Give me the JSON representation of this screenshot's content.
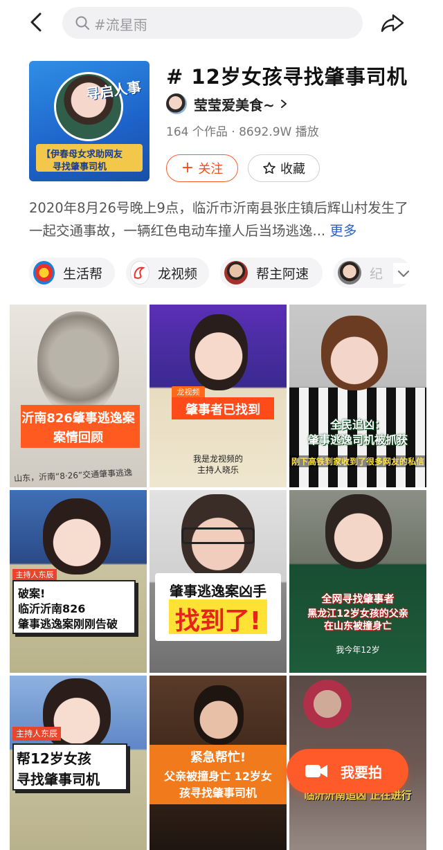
{
  "search": {
    "placeholder": "#流星雨"
  },
  "topic": {
    "title": "# 12岁女孩寻找肇事司机",
    "cover_brand": "寻启人事",
    "cover_banner_line1": "【伊春母女求助网友",
    "cover_banner_line2": "寻找肇事司机"
  },
  "author": {
    "name": "莹莹爱美食~"
  },
  "stats": "164 个作品 · 8692.9W 播放",
  "buttons": {
    "follow": "关注",
    "favorite": "收藏"
  },
  "description": {
    "text": "2020年8月26号晚上9点，临沂市沂南县张庄镇后辉山村发生了一起交通事故，一辆红色电动车撞人后当场逃逸...",
    "more": "更多"
  },
  "creators": [
    {
      "name": "生活帮"
    },
    {
      "name": "龙视频"
    },
    {
      "name": "帮主阿速"
    },
    {
      "name": "纪"
    }
  ],
  "videos": [
    {
      "caption1": "沂南826肇事逃逸案",
      "caption2": "案情回顾",
      "extra": "山东，沂南“8·26”交通肇事逃逸"
    },
    {
      "tag": "龙视频",
      "caption1": "肇事者已找到",
      "sub1": "我是龙视频的",
      "sub2": "主持人晓乐"
    },
    {
      "caption1": "全民追凶：",
      "caption2": "肇事逃逸司机被抓获",
      "sub1": "刚下高铁到家收到了很多网友的私信"
    },
    {
      "tag": "主持人东辰",
      "caption1": "破案!",
      "caption2": "临沂沂南826",
      "caption3": "肇事逃逸案刚刚告破"
    },
    {
      "caption1": "肇事逃逸案凶手",
      "caption2": "找到了!"
    },
    {
      "caption1": "全网寻找肇事者",
      "caption2": "黑龙江12岁女孩的父亲",
      "caption3": "在山东被撞身亡",
      "sub1": "我今年12岁"
    },
    {
      "tag": "主持人东辰",
      "caption1": "帮12岁女孩",
      "caption2": "寻找肇事司机"
    },
    {
      "caption1": "紧急帮忙!",
      "caption2": "父亲被撞身亡 12岁女",
      "caption3": "孩寻找肇事司机"
    },
    {
      "caption1": "临沂沂南追凶 正在进行"
    }
  ],
  "shoot": {
    "label": "我要拍"
  },
  "colors": {
    "accent": "#ff5a2a",
    "link": "#2a62c9"
  }
}
